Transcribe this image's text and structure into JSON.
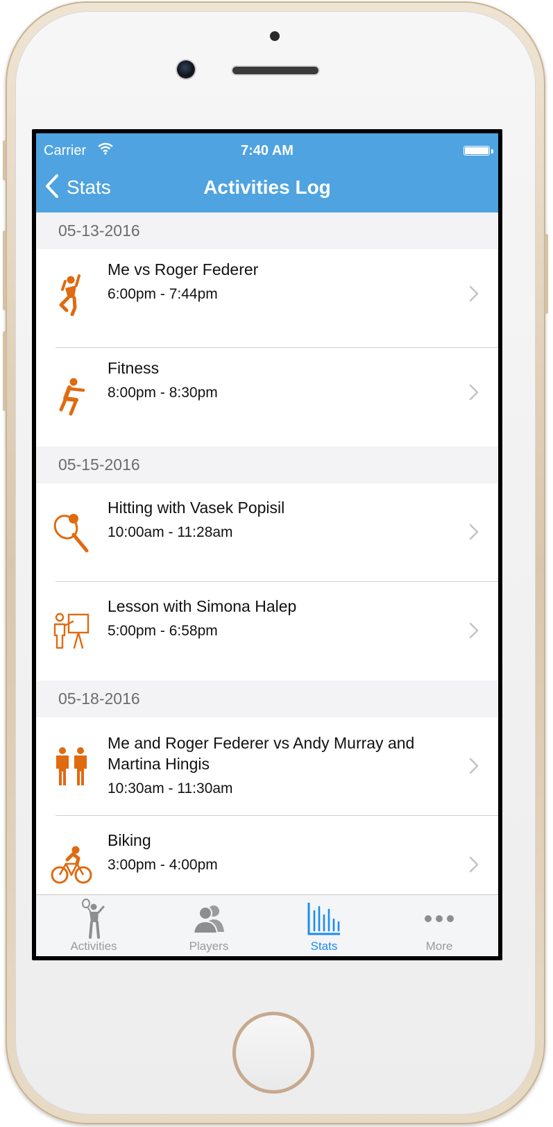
{
  "status_bar": {
    "carrier": "Carrier",
    "time": "7:40 AM"
  },
  "nav": {
    "back_label": "Stats",
    "title": "Activities Log"
  },
  "sections": [
    {
      "date": "05-13-2016",
      "items": [
        {
          "title": "Me vs Roger Federer",
          "time": "6:00pm - 7:44pm",
          "icon": "tennis-player-icon"
        },
        {
          "title": "Fitness",
          "time": "8:00pm - 8:30pm",
          "icon": "fitness-icon"
        }
      ]
    },
    {
      "date": "05-15-2016",
      "items": [
        {
          "title": "Hitting with Vasek Popisil",
          "time": "10:00am - 11:28am",
          "icon": "tennis-racket-icon"
        },
        {
          "title": "Lesson with Simona Halep",
          "time": "5:00pm - 6:58pm",
          "icon": "lesson-icon"
        }
      ]
    },
    {
      "date": "05-18-2016",
      "items": [
        {
          "title": "Me and Roger Federer vs Andy Murray and Martina Hingis",
          "time": "10:30am - 11:30am",
          "icon": "doubles-icon"
        },
        {
          "title": "Biking",
          "time": "3:00pm - 4:00pm",
          "icon": "biking-icon"
        }
      ]
    }
  ],
  "tabbar": {
    "tabs": [
      {
        "label": "Activities",
        "icon": "activities-icon",
        "active": false
      },
      {
        "label": "Players",
        "icon": "players-icon",
        "active": false
      },
      {
        "label": "Stats",
        "icon": "stats-icon",
        "active": true
      },
      {
        "label": "More",
        "icon": "more-icon",
        "active": false
      }
    ]
  },
  "colors": {
    "nav_blue": "#4fa3e0",
    "activity_orange": "#e06a10",
    "tab_active": "#1a8cf0"
  }
}
